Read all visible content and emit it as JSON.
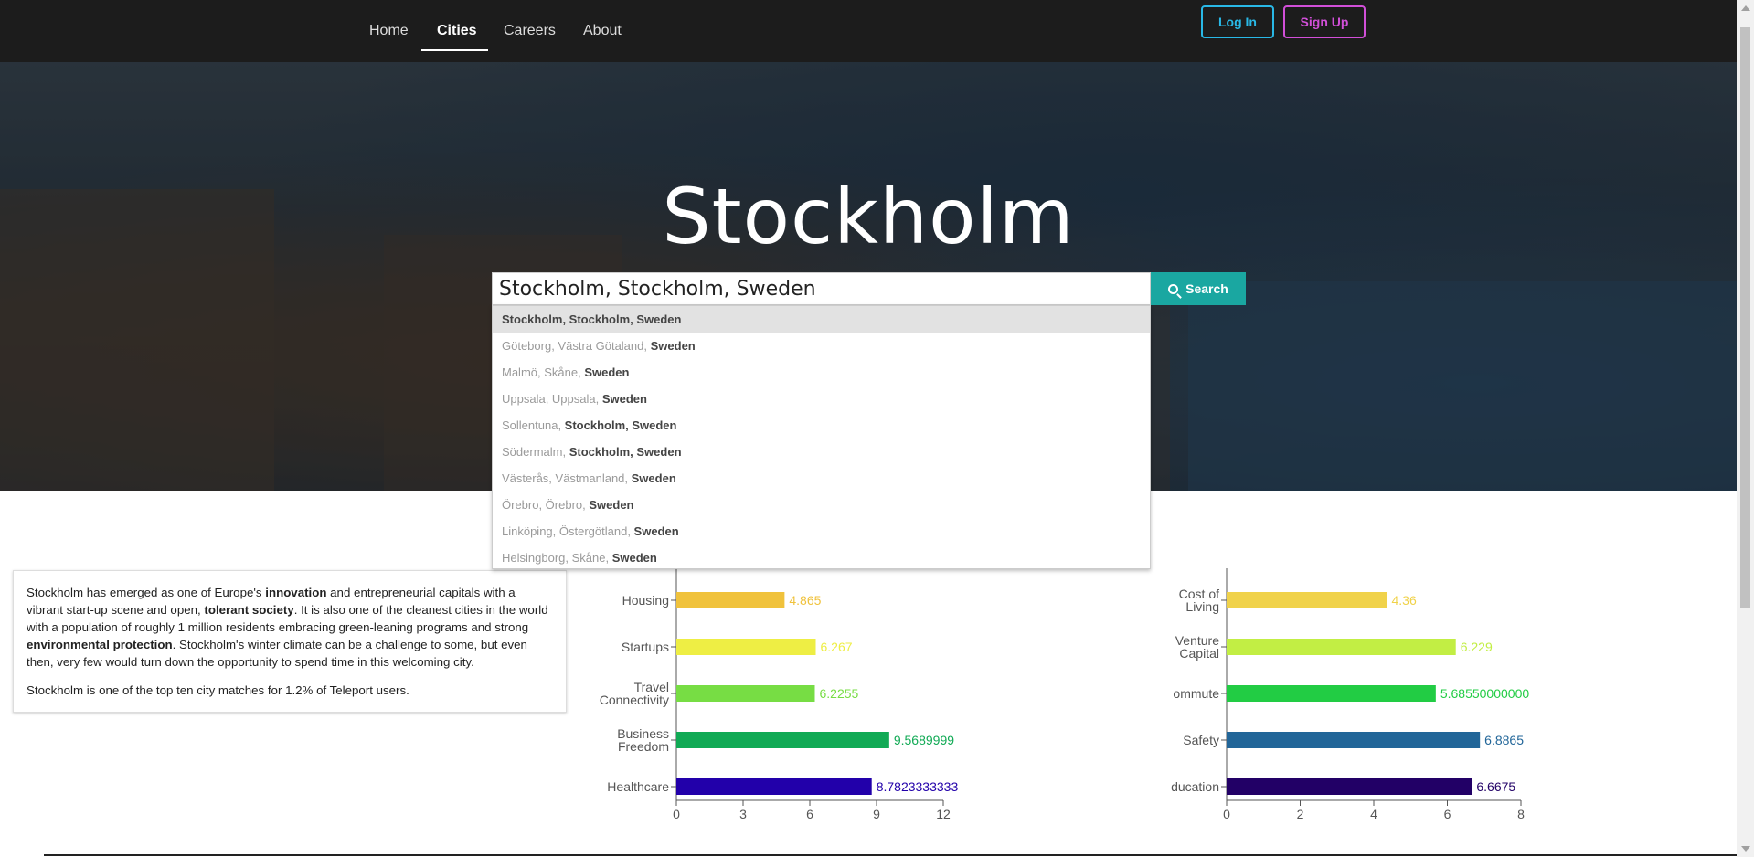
{
  "nav": {
    "items": [
      {
        "label": "Home",
        "active": false
      },
      {
        "label": "Cities",
        "active": true
      },
      {
        "label": "Careers",
        "active": false
      },
      {
        "label": "About",
        "active": false
      }
    ],
    "login_label": "Log In",
    "signup_label": "Sign Up",
    "login_color": "#29b8e6",
    "signup_color": "#d14fd8"
  },
  "hero": {
    "title": "Stockholm"
  },
  "search": {
    "value": "Stockholm, Stockholm, Sweden",
    "button_label": "Search",
    "button_icon": "search-icon",
    "button_color": "#1aa7a1",
    "suggestions": [
      {
        "prefix": "",
        "bold": "Stockholm, Stockholm, Sweden"
      },
      {
        "prefix": "Göteborg, Västra Götaland, ",
        "bold": "Sweden"
      },
      {
        "prefix": "Malmö, Skåne, ",
        "bold": "Sweden"
      },
      {
        "prefix": "Uppsala, Uppsala, ",
        "bold": "Sweden"
      },
      {
        "prefix": "Sollentuna, ",
        "bold": "Stockholm, Sweden"
      },
      {
        "prefix": "Södermalm, ",
        "bold": "Stockholm, Sweden"
      },
      {
        "prefix": "Västerås, Västmanland, ",
        "bold": "Sweden"
      },
      {
        "prefix": "Örebro, Örebro, ",
        "bold": "Sweden"
      },
      {
        "prefix": "Linköping, Östergötland, ",
        "bold": "Sweden"
      },
      {
        "prefix": "Helsingborg, Skåne, ",
        "bold": "Sweden"
      }
    ]
  },
  "summary": {
    "paragraph1": [
      {
        "text": "Stockholm has emerged as one of Europe's ",
        "bold": false
      },
      {
        "text": "innovation",
        "bold": true
      },
      {
        "text": " and entrepreneurial capitals with a vibrant start-up scene and open, ",
        "bold": false
      },
      {
        "text": "tolerant society",
        "bold": true
      },
      {
        "text": ". It is also one of the cleanest cities in the world with a population of roughly 1 million residents embracing green-leaning programs and strong ",
        "bold": false
      },
      {
        "text": "environmental protection",
        "bold": true
      },
      {
        "text": ". Stockholm's winter climate can be a challenge to some, but even then, very few would turn down the opportunity to spend time in this welcoming city.",
        "bold": false
      }
    ],
    "paragraph2": "Stockholm is one of the top ten city matches for 1.2% of Teleport users."
  },
  "chart_data": [
    {
      "type": "bar",
      "orientation": "horizontal",
      "categories": [
        [
          "Housing"
        ],
        [
          "Startups"
        ],
        [
          "Travel",
          "Connectivity"
        ],
        [
          "Business",
          "Freedom"
        ],
        [
          "Healthcare"
        ]
      ],
      "values": [
        4.865,
        6.267,
        6.2255,
        9.5689999,
        8.7823333333
      ],
      "value_labels": [
        "4.865",
        "6.267",
        "6.2255",
        "9.5689999",
        "8.7823333333"
      ],
      "colors": [
        "#f0c23c",
        "#eeee44",
        "#77dd44",
        "#11aa55",
        "#2200aa"
      ],
      "xlim": [
        0,
        12
      ],
      "xticks": [
        "0",
        "3",
        "6",
        "9",
        "12"
      ],
      "grid": false
    },
    {
      "type": "bar",
      "orientation": "horizontal",
      "categories": [
        [
          "Cost of",
          "Living"
        ],
        [
          "Venture",
          "Capital"
        ],
        [
          "ommute"
        ],
        [
          "Safety"
        ],
        [
          "ducation"
        ]
      ],
      "values": [
        4.36,
        6.229,
        5.6855,
        6.8865,
        6.6675
      ],
      "value_labels": [
        "4.36",
        "6.229",
        "5.68550000000",
        "6.8865",
        "6.6675"
      ],
      "colors": [
        "#f0d24a",
        "#c2ee44",
        "#22cc44",
        "#226699",
        "#220066"
      ],
      "xlim": [
        0,
        8
      ],
      "xticks": [
        "0",
        "2",
        "4",
        "6",
        "8"
      ],
      "grid": false
    }
  ]
}
